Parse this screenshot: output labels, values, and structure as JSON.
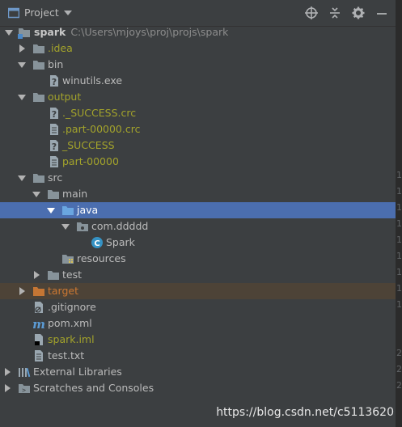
{
  "header": {
    "title": "Project"
  },
  "tree": {
    "root": {
      "name": "spark",
      "path": "C:\\Users\\mjoys\\proj\\projs\\spark"
    },
    "idea": ".idea",
    "bin": "bin",
    "winutils": "winutils.exe",
    "output": "output",
    "success_crc": "._SUCCESS.crc",
    "part_crc": ".part-00000.crc",
    "success": "_SUCCESS",
    "part": "part-00000",
    "src": "src",
    "main": "main",
    "java": "java",
    "package": "com.ddddd",
    "spark_class": "Spark",
    "resources": "resources",
    "test": "test",
    "target": "target",
    "gitignore": ".gitignore",
    "pom": "pom.xml",
    "iml": "spark.iml",
    "testtxt": "test.txt",
    "external_libraries": "External Libraries",
    "scratches": "Scratches and Consoles"
  },
  "gutter": [
    "1",
    "1",
    "1",
    "1",
    "1",
    "1",
    "1",
    "1",
    "1",
    "2",
    "2",
    "2"
  ],
  "watermark": "https://blog.csdn.net/c5113620",
  "colors": {
    "background": "#3c3f41",
    "selection": "#4b6eaf",
    "excluded": "#4d4337",
    "folder": "#87939a",
    "source_folder": "#4a88c7",
    "excluded_folder": "#c57634",
    "olive_text": "#a3a32b"
  }
}
